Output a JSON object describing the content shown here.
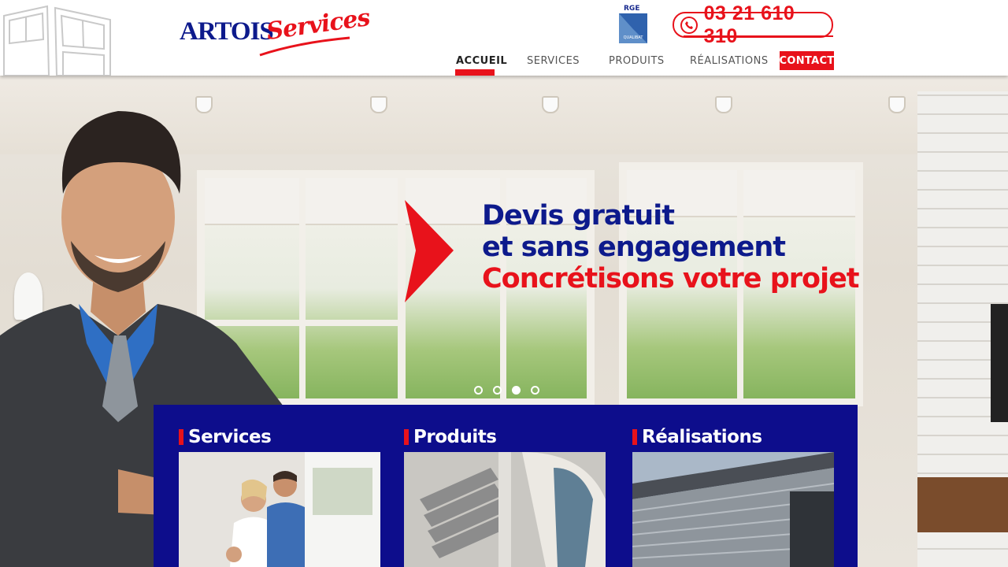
{
  "brand": {
    "name_part1": "ARTOIS",
    "name_part2": "Services"
  },
  "certification": {
    "label": "RGE",
    "sublabel": "QUALIBAT"
  },
  "phone": {
    "number": "03 21 610 310"
  },
  "nav": {
    "items": [
      {
        "label": "ACCUEIL",
        "active": true
      },
      {
        "label": "SERVICES",
        "active": false
      },
      {
        "label": "PRODUITS",
        "active": false
      },
      {
        "label": "RÉALISATIONS",
        "active": false
      }
    ],
    "contact_label": "CONTACT"
  },
  "hero": {
    "line1": "Devis gratuit",
    "line2": "et sans engagement",
    "line3": "Concrétisons votre projet",
    "slides": 4,
    "active_slide": 3
  },
  "sections": [
    {
      "title": "Services"
    },
    {
      "title": "Produits"
    },
    {
      "title": "Réalisations"
    }
  ],
  "colors": {
    "brand_blue": "#0d1a8c",
    "panel_blue": "#0d0d8c",
    "accent_red": "#e8121b"
  },
  "icons": {
    "phone": "phone-icon",
    "hero_arrow": "chevron-right-icon"
  }
}
